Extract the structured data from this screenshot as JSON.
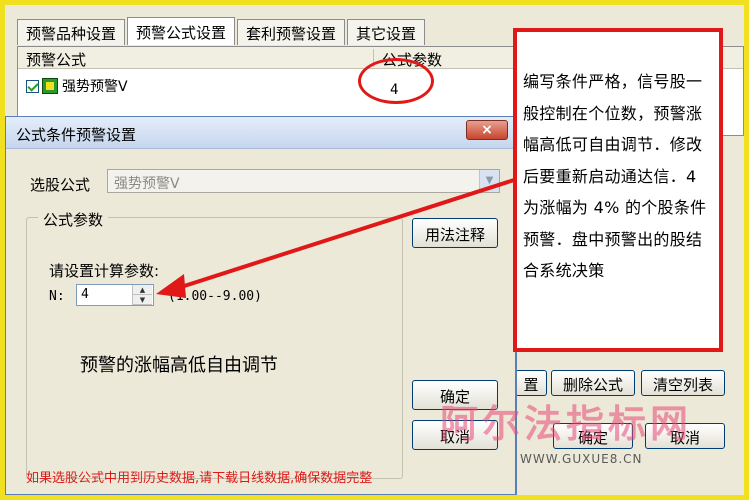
{
  "tabs": [
    "预警品种设置",
    "预警公式设置",
    "套利预警设置",
    "其它设置"
  ],
  "active_tab": 1,
  "list": {
    "col_formula": "预警公式",
    "col_params": "公式参数",
    "row_formula": "强势预警V",
    "row_param": "4"
  },
  "bg_buttons": {
    "partial": "置",
    "delete": "删除公式",
    "clear": "清空列表"
  },
  "dialog": {
    "title": "公式条件预警设置",
    "close": "×",
    "formula_label": "选股公式",
    "formula_value": "强势预警V",
    "group_label": "公式参数",
    "usage_button": "用法注释",
    "calc_label": "请设置计算参数:",
    "n_label": "N:",
    "n_value": "4",
    "range": "(1.00--9.00)",
    "caption": "预警的涨幅高低自由调节",
    "ok": "确定",
    "cancel": "取消",
    "warning": "如果选股公式中用到历史数据,请下载日线数据,确保数据完整"
  },
  "note": "编写条件严格，信号股一般控制在个位数，预警涨幅高低可自由调节．修改后要重新启动通达信．4 为涨幅为 4% 的个股条件预警．盘中预警出的股结合系统决策",
  "watermark": {
    "text": "阿尔法指标网",
    "site": "WWW.GUXUE8.CN"
  },
  "colors": {
    "annotation": "#e01818",
    "frame": "#f0e020",
    "watermark": "#e84a78"
  }
}
